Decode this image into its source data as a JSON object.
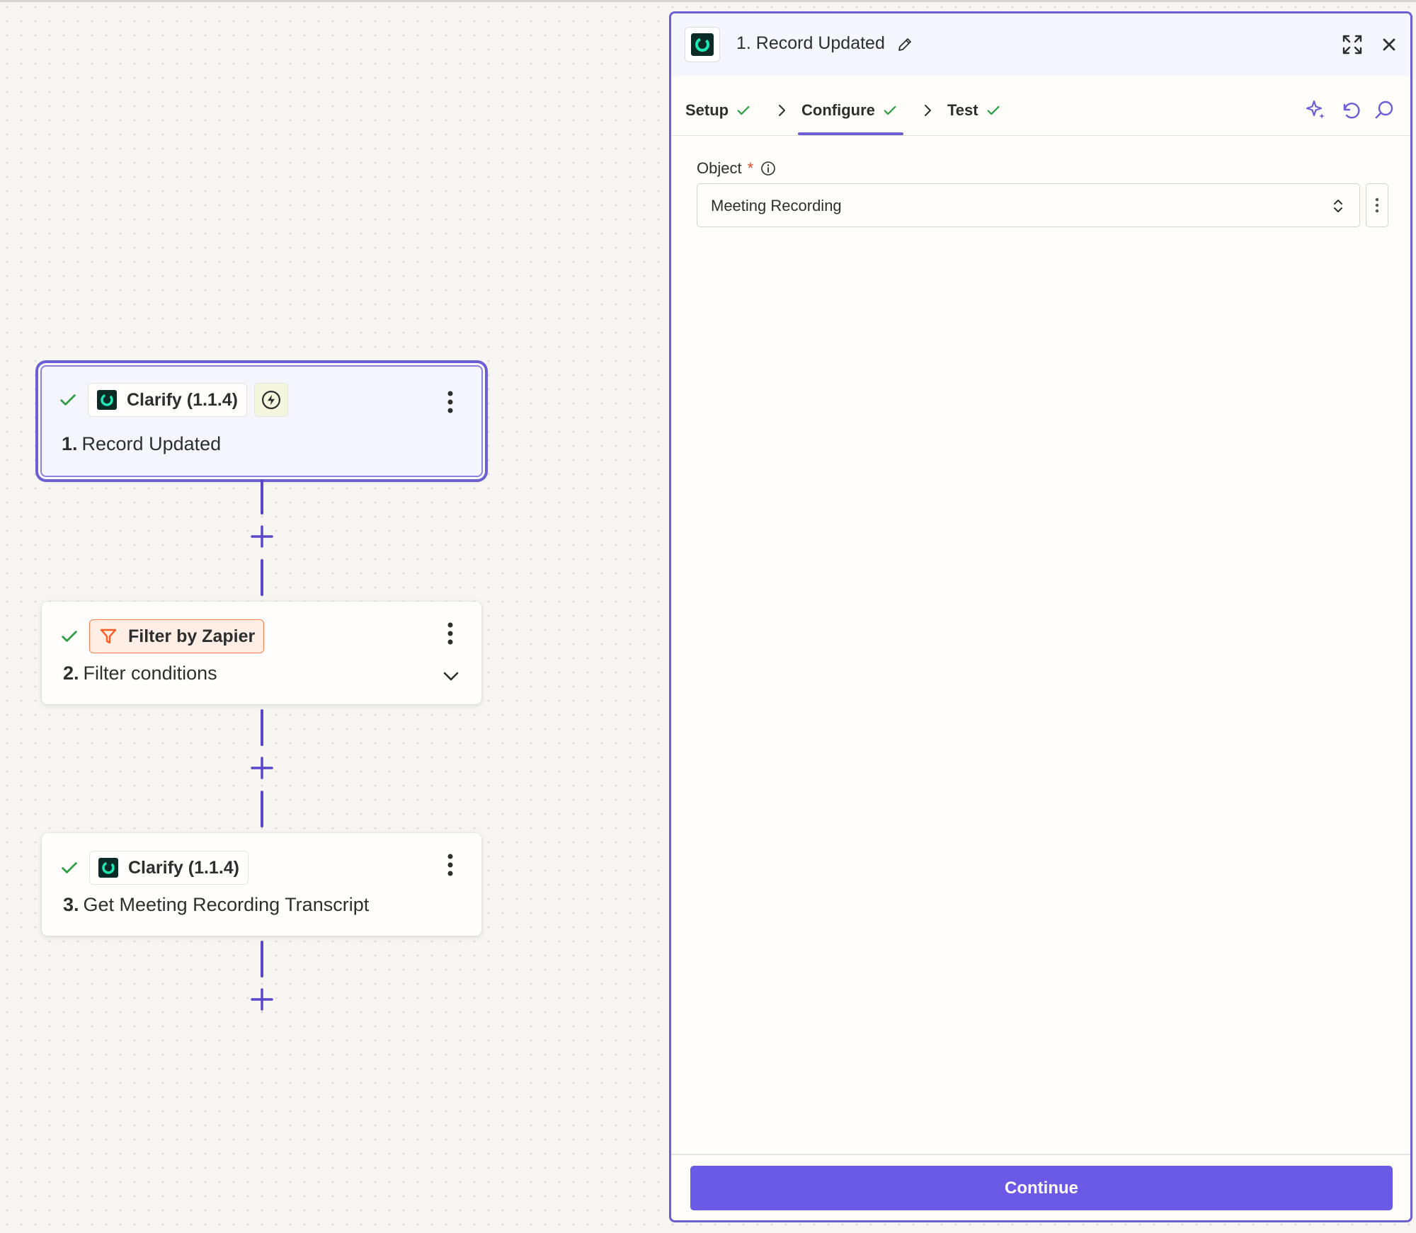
{
  "canvas": {
    "steps": [
      {
        "app_label": "Clarify (1.1.4)",
        "number": "1.",
        "title": "Record Updated",
        "icon": "clarify-logo-icon",
        "has_trigger_badge": true,
        "selected": true
      },
      {
        "app_label": "Filter by Zapier",
        "number": "2.",
        "title": "Filter conditions",
        "icon": "filter-icon",
        "collapsible": true
      },
      {
        "app_label": "Clarify (1.1.4)",
        "number": "3.",
        "title": "Get Meeting Recording Transcript",
        "icon": "clarify-logo-icon"
      }
    ]
  },
  "panel": {
    "title": "1. Record Updated",
    "tabs": [
      {
        "label": "Setup",
        "complete": true
      },
      {
        "label": "Configure",
        "complete": true,
        "active": true
      },
      {
        "label": "Test",
        "complete": true
      }
    ],
    "tools": [
      "sparkle-icon",
      "undo-icon",
      "search-icon"
    ],
    "field": {
      "label": "Object",
      "required_marker": "*",
      "value": "Meeting Recording"
    },
    "continue_label": "Continue"
  },
  "colors": {
    "accent": "#6b5fd6",
    "button": "#6b5ae6",
    "check": "#2f9e44",
    "filter_accent": "#ff7b4a",
    "clarify_teal": "#1de9b6"
  }
}
